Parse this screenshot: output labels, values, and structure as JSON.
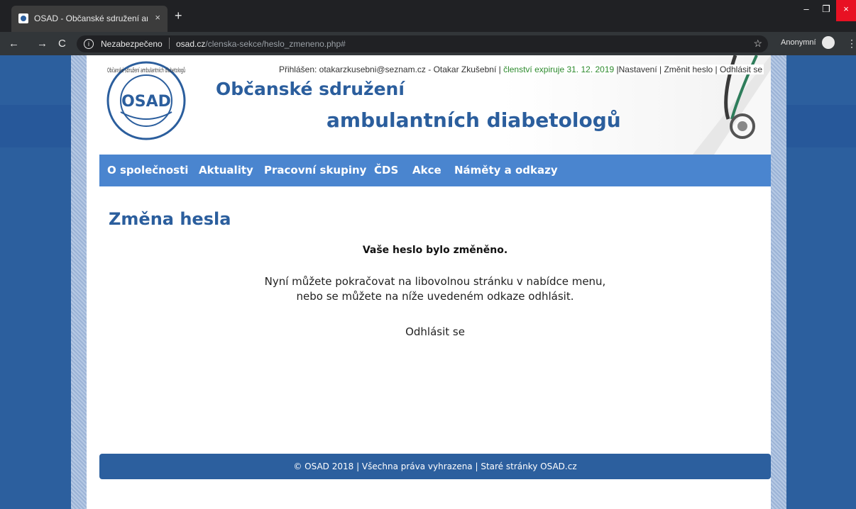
{
  "browser": {
    "tab_title": "OSAD - Občanské sdružení ambu...",
    "tab_close": "×",
    "new_tab": "+",
    "security": "Nezabezpečeno",
    "url_domain": "osad.cz",
    "url_path": "/clenska-sekce/heslo_zmeneno.php#",
    "profile_label": "Anonymní",
    "win_min": "–",
    "win_max": "❐",
    "win_close": "×"
  },
  "header": {
    "logo_text": "OSAD",
    "logo_ring_text": "Občanské sdružení ambulantních diabetologů",
    "site_name_line1": "Občanské sdružení",
    "site_name_line2": "ambulantních diabetologů",
    "user_prefix": "Přihlášen: otakarzkusebni@seznam.cz - Otakar Zkušební | ",
    "membership": "členství expiruje 31. 12. 2019",
    "settings": " |Nastavení",
    "sep1": " | ",
    "change_password": "Změnit heslo",
    "sep2": " | ",
    "logout": "Odhlásit se"
  },
  "nav": {
    "items": [
      "O společnosti",
      "Aktuality",
      "Pracovní skupiny",
      "ČDS",
      "Akce",
      "Náměty a odkazy"
    ]
  },
  "content": {
    "heading": "Změna hesla",
    "confirmation": "Vaše heslo bylo změněno.",
    "info_line1": "Nyní můžete pokračovat na libovolnou stránku v nabídce menu,",
    "info_line2": "nebo se můžete na níže uvedeném odkaze odhlásit.",
    "logout_link": "Odhlásit se"
  },
  "footer": {
    "text": "© OSAD 2018 | Všechna práva vyhrazena | Staré stránky OSAD.cz"
  },
  "colors": {
    "brand_blue": "#2b5e9d",
    "nav_blue": "#4a85cf",
    "membership_green": "#2e8b2e"
  }
}
